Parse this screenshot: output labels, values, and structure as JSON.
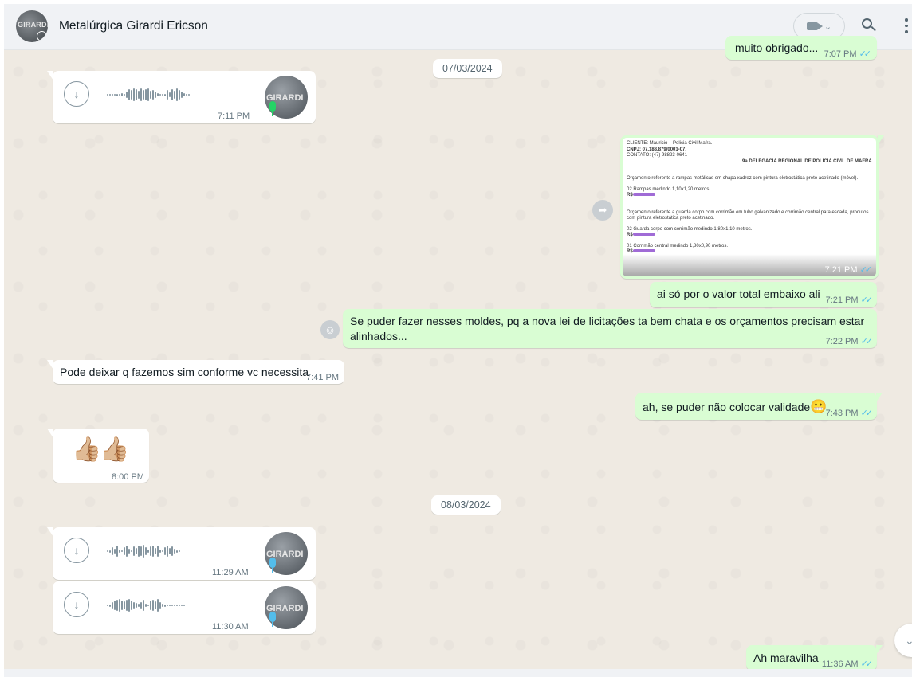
{
  "header": {
    "contact_name": "Metalúrgica Girardi Ericson",
    "avatar_text": "GIRARDI",
    "video_icon": "video-camera-icon",
    "dropdown_icon": "chevron-down-icon",
    "search_icon": "search-icon",
    "menu_icon": "kebab-menu-icon"
  },
  "colors": {
    "incoming_bubble": "#ffffff",
    "outgoing_bubble": "#d9fdd3",
    "read_ticks": "#53bdeb",
    "chat_bg": "#efeae2"
  },
  "messages": {
    "top_partial": {
      "text": "muito obrigado...",
      "time": "7:07 PM"
    },
    "date_1": "07/03/2024",
    "voice_1": {
      "avatar_text": "GIRARDI",
      "time": "7:11 PM"
    },
    "image_1": {
      "time": "7:21 PM",
      "lines": {
        "client": "CLIENTE: Mauricio – Policia Civil Mafra.",
        "cnpj": "CNPJ: 07.188.879/0001-07.",
        "contact": "CONTATO: (47) 98823-0641",
        "dept": "9a DELEGACIA REGIONAL DE POLICIA CIVIL DE MAFRA",
        "p1": "Orçamento referente a rampas metálicas em chapa xadrez com pintura eletrostática preto acetinado (móvel).",
        "i1": "02 Rampas medindo 1,10x1,20 metros.",
        "rs": "R$",
        "p2": "Orçamento referente a guarda corpo com corrimão em tubo galvanizado e corrimão central para escada, produtos com pintura eletrostática preto acetinado.",
        "i2": "02 Guarda corpo com corrimão medindo 1,80x1,10 metros.",
        "i3": "01 Corrimão central medindo 1,80x0,90 metros."
      }
    },
    "out_1": {
      "text": "ai só por o valor total embaixo ali",
      "time": "7:21 PM"
    },
    "out_2": {
      "text": "Se puder fazer nesses moldes, pq a nova lei de licitações ta bem chata e os orçamentos precisam estar alinhados...",
      "time": "7:22 PM"
    },
    "in_1": {
      "text": "Pode deixar q fazemos sim conforme vc necessita",
      "time": "7:41 PM"
    },
    "out_3": {
      "text": "ah, se puder não colocar validade",
      "emoji": "😬",
      "time": "7:43 PM"
    },
    "in_2": {
      "emoji": "👍🏼👍🏼",
      "time": "8:00 PM"
    },
    "date_2": "08/03/2024",
    "voice_2": {
      "avatar_text": "GIRARDI",
      "time": "11:29 AM"
    },
    "voice_3": {
      "avatar_text": "GIRARDI",
      "time": "11:30 AM"
    },
    "out_4": {
      "text": "Ah maravilha",
      "time": "11:36 AM"
    }
  },
  "ticks": "✓✓"
}
